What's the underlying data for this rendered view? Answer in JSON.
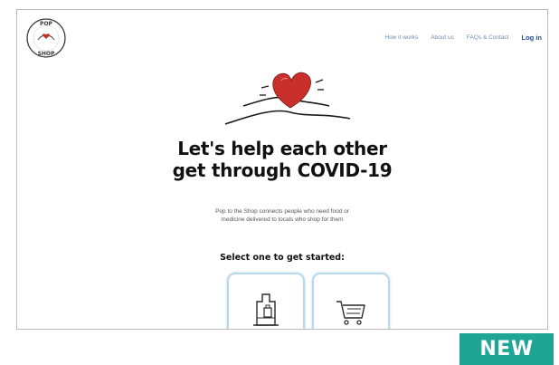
{
  "header": {
    "logo_top_text": "POP",
    "logo_bottom_text": "SHOP",
    "logo_icon": "pop-to-the-shop-logo-icon",
    "nav": [
      {
        "label": "How it works"
      },
      {
        "label": "About us"
      },
      {
        "label": "FAQs & Contact"
      },
      {
        "label": "Log in"
      }
    ]
  },
  "hero": {
    "illustration_icon": "heart-hands-icon",
    "title_line1": "Let's help each other",
    "title_line2": "get through COVID-19",
    "subtitle_line1": "Pop to the Shop connects people who need food or",
    "subtitle_line2": "medicine delivered to locals who shop for them",
    "select_label": "Select one to get started:"
  },
  "options": [
    {
      "icon": "shopping-bag-icon"
    },
    {
      "icon": "shopping-cart-icon"
    }
  ],
  "badge": {
    "label": "NEW"
  },
  "colors": {
    "heart": "#c9302c",
    "nav_link": "#6b8fb5",
    "login": "#1f4f93",
    "card_border": "#b9d9ea",
    "badge": "#1fa594"
  }
}
